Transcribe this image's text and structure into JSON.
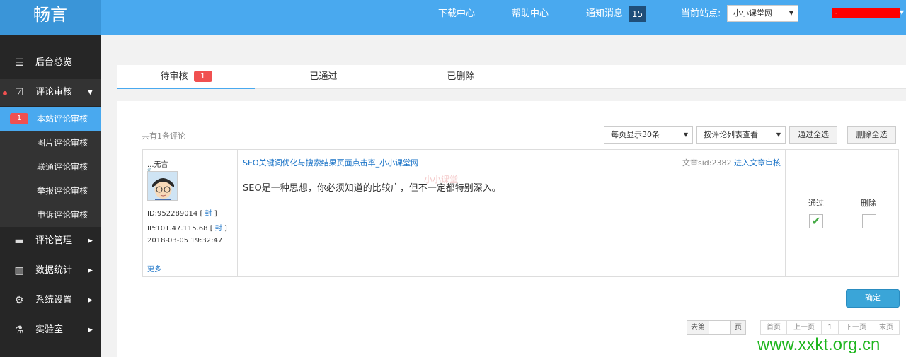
{
  "header": {
    "logo": "畅言",
    "links": [
      "下载中心",
      "帮助中心",
      "通知消息"
    ],
    "notice_count": "15",
    "site_label": "当前站点:",
    "site_value": "小小课堂网",
    "user_name": "-"
  },
  "sidebar": {
    "items": [
      {
        "label": "后台总览",
        "icon": "menu-icon"
      },
      {
        "label": "评论审核",
        "icon": "clipboard-check-icon"
      },
      {
        "label": "评论管理",
        "icon": "folder-icon"
      },
      {
        "label": "数据统计",
        "icon": "bar-chart-icon"
      },
      {
        "label": "系统设置",
        "icon": "gear-icon"
      },
      {
        "label": "实验室",
        "icon": "flask-icon"
      }
    ],
    "subitems": [
      {
        "label": "本站评论审核",
        "count": "1"
      },
      {
        "label": "图片评论审核"
      },
      {
        "label": "联通评论审核"
      },
      {
        "label": "举报评论审核"
      },
      {
        "label": "申诉评论审核"
      }
    ]
  },
  "tabs": [
    {
      "label": "待审核",
      "count": "1"
    },
    {
      "label": "已通过"
    },
    {
      "label": "已删除"
    }
  ],
  "toolbar": {
    "total": "共有1条评论",
    "per_page": "每页显示30条",
    "view_mode": "按评论列表查看",
    "approve_all": "通过全选",
    "delete_all": "删除全选"
  },
  "comment": {
    "user": "...无言",
    "id_line": "ID:952289014",
    "ip_line": "IP:101.47.115.68",
    "ban": "封",
    "time": "2018-03-05 19:32:47",
    "more": "更多",
    "article_title": "SEO关键词优化与搜索结果页面点击率_小小课堂网",
    "article_sid": "文章sid:2382",
    "enter_review": "进入文章审核",
    "content": "SEO是一种思想，你必须知道的比较广，但不一定都特别深入。",
    "watermark": "小小课堂",
    "approve_label": "通过",
    "delete_label": "删除",
    "approve_checked": true,
    "delete_checked": false
  },
  "confirm": "确定",
  "pagination": {
    "goto_label": "去第",
    "goto_suffix": "页",
    "first": "首页",
    "prev": "上一页",
    "current": "1",
    "next": "下一页",
    "last": "末页"
  },
  "watermark_url": "www.xxkt.org.cn",
  "colors": {
    "header": "#49a9ef",
    "sidebar": "#262626",
    "accent": "#49a9ef",
    "badge": "#f05050"
  }
}
